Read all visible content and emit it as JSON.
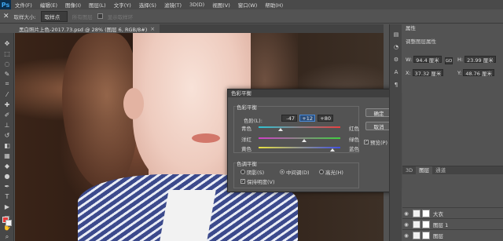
{
  "app": {
    "logo": "Ps"
  },
  "menu": [
    "文件(F)",
    "编辑(E)",
    "图像(I)",
    "图层(L)",
    "文字(Y)",
    "选择(S)",
    "滤镜(T)",
    "3D(D)",
    "视图(V)",
    "窗口(W)",
    "帮助(H)"
  ],
  "options": {
    "sample_size_label": "取样大小:",
    "sample_size_value": "取样点",
    "all_layers": "所有图层",
    "show_ring": "显示取样环"
  },
  "document": {
    "tab_title": "黑白照片上色-2017.73.psd @ 28% (图层 6, RGB/8#)"
  },
  "dialog": {
    "title": "色彩平衡",
    "balance_group": "色彩平衡",
    "levels_label": "色阶(L):",
    "levels": [
      "-47",
      "+12",
      "+80"
    ],
    "sliders": [
      {
        "left": "青色",
        "right": "红色",
        "value": -47,
        "track_color_left": "#2ec4d4",
        "track_color_right": "#e84040"
      },
      {
        "left": "洋红",
        "right": "绿色",
        "value": 12,
        "track_color_left": "#d040c8",
        "track_color_right": "#40d040"
      },
      {
        "left": "黄色",
        "right": "蓝色",
        "value": 80,
        "track_color_left": "#e8e040",
        "track_color_right": "#4050e0"
      }
    ],
    "tone_group": "色调平衡",
    "tone_options": [
      "阴影(S)",
      "中间调(D)",
      "高光(H)"
    ],
    "tone_selected": 1,
    "preserve_luminosity": "保持明度(V)",
    "preserve_checked": true,
    "ok": "确定",
    "cancel": "取消",
    "preview": "预览(P)",
    "preview_checked": true
  },
  "properties": {
    "tab": "属性",
    "header": "调整图层属性",
    "w_label": "W:",
    "w_value": "94.4 厘米",
    "go_label": "GO",
    "h_label": "H:",
    "h_value": "23.99 厘米",
    "x_label": "X:",
    "x_value": "37.32 厘米",
    "y_label": "Y:",
    "y_value": "48.76 厘米"
  },
  "layers_panel": {
    "tabs": [
      "3D",
      "图层",
      "通道"
    ],
    "active_tab": 1,
    "layers": [
      {
        "name": "大衣"
      },
      {
        "name": "图层 1"
      },
      {
        "name": "图层"
      }
    ]
  }
}
